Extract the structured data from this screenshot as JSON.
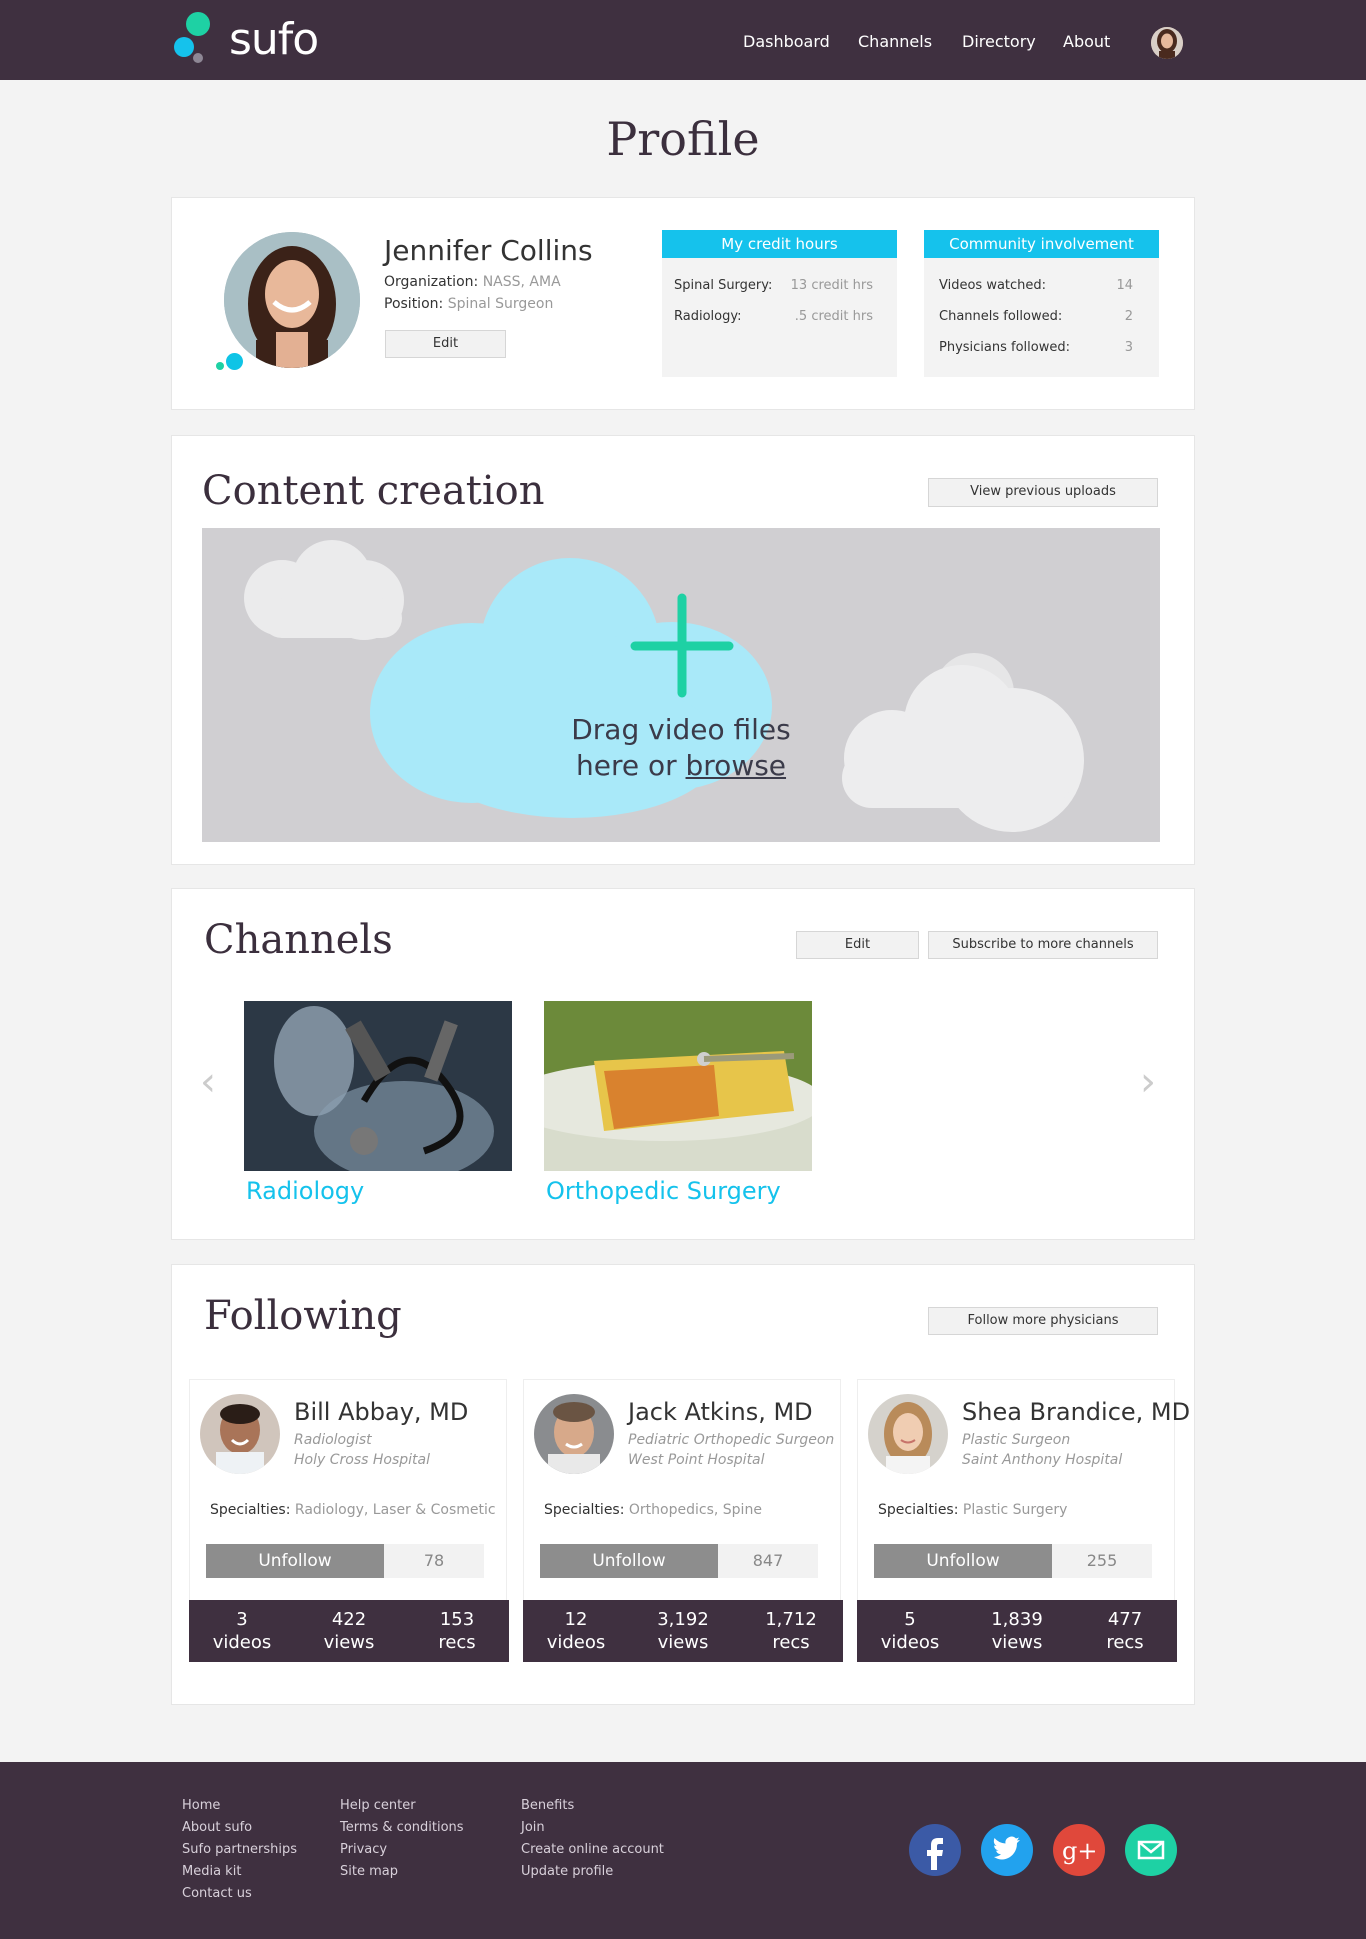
{
  "header": {
    "brand": "sufo",
    "nav": [
      "Dashboard",
      "Channels",
      "Directory",
      "About"
    ]
  },
  "page": {
    "title": "Profile"
  },
  "profile": {
    "name": "Jennifer Collins",
    "organization_label": "Organization:",
    "organization_value": "NASS, AMA",
    "position_label": "Position:",
    "position_value": "Spinal Surgeon",
    "edit_label": "Edit",
    "credit": {
      "title": "My credit hours",
      "rows": [
        {
          "label": "Spinal Surgery:",
          "value": "13 credit hrs"
        },
        {
          "label": "Radiology:",
          "value": ".5 credit hrs"
        }
      ]
    },
    "community": {
      "title": "Community involvement",
      "rows": [
        {
          "label": "Videos watched:",
          "value": "14"
        },
        {
          "label": "Channels followed:",
          "value": "2"
        },
        {
          "label": "Physicians followed:",
          "value": "3"
        }
      ]
    }
  },
  "content_creation": {
    "title": "Content creation",
    "view_previous_label": "View previous uploads",
    "drop_line1": "Drag video files",
    "drop_line2_prefix": "here or ",
    "drop_browse": "browse"
  },
  "channels": {
    "title": "Channels",
    "edit_label": "Edit",
    "subscribe_label": "Subscribe to more channels",
    "items": [
      {
        "label": "Radiology"
      },
      {
        "label": "Orthopedic Surgery"
      }
    ]
  },
  "following": {
    "title": "Following",
    "follow_more_label": "Follow more physicians",
    "specialties_label": "Specialties:",
    "unfollow_label": "Unfollow",
    "people": [
      {
        "name": "Bill Abbay, MD",
        "role": "Radiologist",
        "hospital": "Holy Cross Hospital",
        "specialties": "Radiology, Laser & Cosmetic",
        "followers": "78",
        "videos": "3",
        "videos_label": "videos",
        "views": "422",
        "views_label": "views",
        "recs": "153",
        "recs_label": "recs"
      },
      {
        "name": "Jack Atkins, MD",
        "role": "Pediatric Orthopedic Surgeon",
        "hospital": "West Point Hospital",
        "specialties": "Orthopedics, Spine",
        "followers": "847",
        "videos": "12",
        "videos_label": "videos",
        "views": "3,192",
        "views_label": "views",
        "recs": "1,712",
        "recs_label": "recs"
      },
      {
        "name": "Shea Brandice, MD",
        "role": "Plastic Surgeon",
        "hospital": "Saint Anthony Hospital",
        "specialties": "Plastic Surgery",
        "followers": "255",
        "videos": "5",
        "videos_label": "videos",
        "views": "1,839",
        "views_label": "views",
        "recs": "477",
        "recs_label": "recs"
      }
    ]
  },
  "footer": {
    "col1": [
      "Home",
      "About sufo",
      "Sufo partnerships",
      "Media kit",
      "Contact us"
    ],
    "col2": [
      "Help center",
      "Terms & conditions",
      "Privacy",
      "Site map"
    ],
    "col3": [
      "Benefits",
      "Join",
      "Create online account",
      "Update profile"
    ],
    "social": [
      "facebook-icon",
      "twitter-icon",
      "google-plus-icon",
      "email-icon"
    ]
  },
  "colors": {
    "header_bg": "#3f3040",
    "accent": "#15c2ec",
    "brand_green": "#1ed1a4"
  }
}
